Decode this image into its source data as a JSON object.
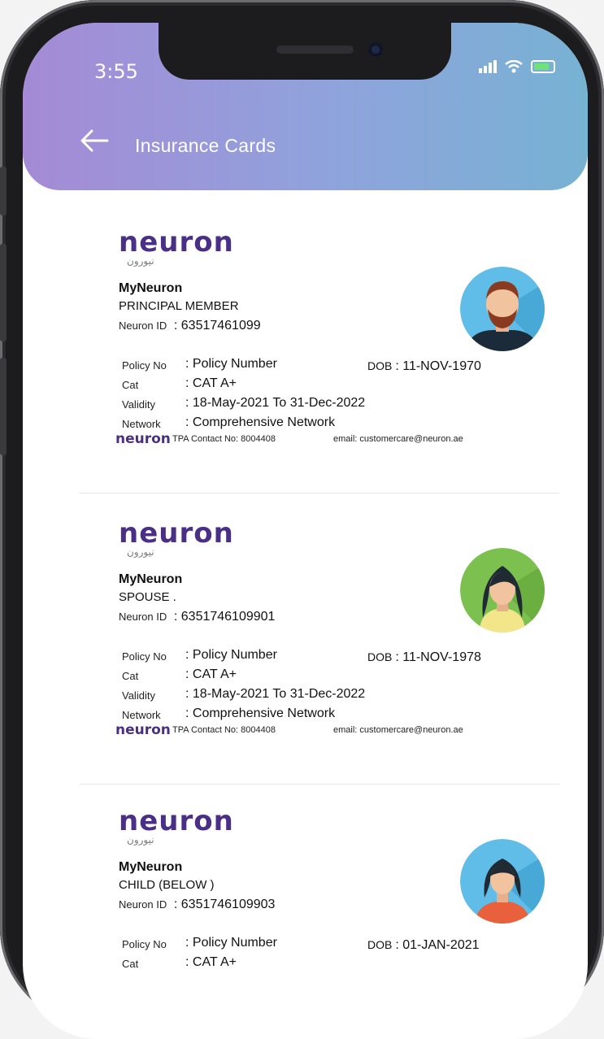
{
  "status_bar": {
    "time": "3:55"
  },
  "header": {
    "title": "Insurance Cards"
  },
  "labels": {
    "neuron_id": "Neuron ID",
    "policy_no": "Policy No",
    "cat": "Cat",
    "validity": "Validity",
    "network": "Network",
    "dob": "DOB",
    "colon": ":",
    "to": "To"
  },
  "cards": [
    {
      "company": "MyNeuron",
      "member_type": "PRINCIPAL  MEMBER",
      "neuron_id": "63517461099",
      "policy_no": "Policy Number",
      "cat": "CAT A+",
      "validity_from": "18-May-2021",
      "validity_to": "31-Dec-2022",
      "network": "Comprehensive Network",
      "dob": "11-NOV-1970",
      "tpa": "TPA Contact No: 8004408",
      "email": "email: customercare@neuron.ae",
      "avatar": "man-avatar"
    },
    {
      "company": "MyNeuron",
      "member_type": "SPOUSE .",
      "neuron_id": "6351746109901",
      "policy_no": "Policy Number",
      "cat": "CAT A+",
      "validity_from": "18-May-2021",
      "validity_to": "31-Dec-2022",
      "network": "Comprehensive Network",
      "dob": "11-NOV-1978",
      "tpa": "TPA Contact No: 8004408",
      "email": "email: customercare@neuron.ae",
      "avatar": "woman-avatar"
    },
    {
      "company": "MyNeuron",
      "member_type": "CHILD (BELOW )",
      "neuron_id": "6351746109903",
      "policy_no": "Policy Number",
      "cat": "CAT A+",
      "dob": "01-JAN-2021",
      "avatar": "child-avatar"
    }
  ],
  "logo": {
    "word": "neuron",
    "arabic": "نيورون"
  },
  "colors": {
    "header_start": "#a58ad6",
    "header_end": "#77b2d3",
    "brand": "#4a2f86"
  }
}
